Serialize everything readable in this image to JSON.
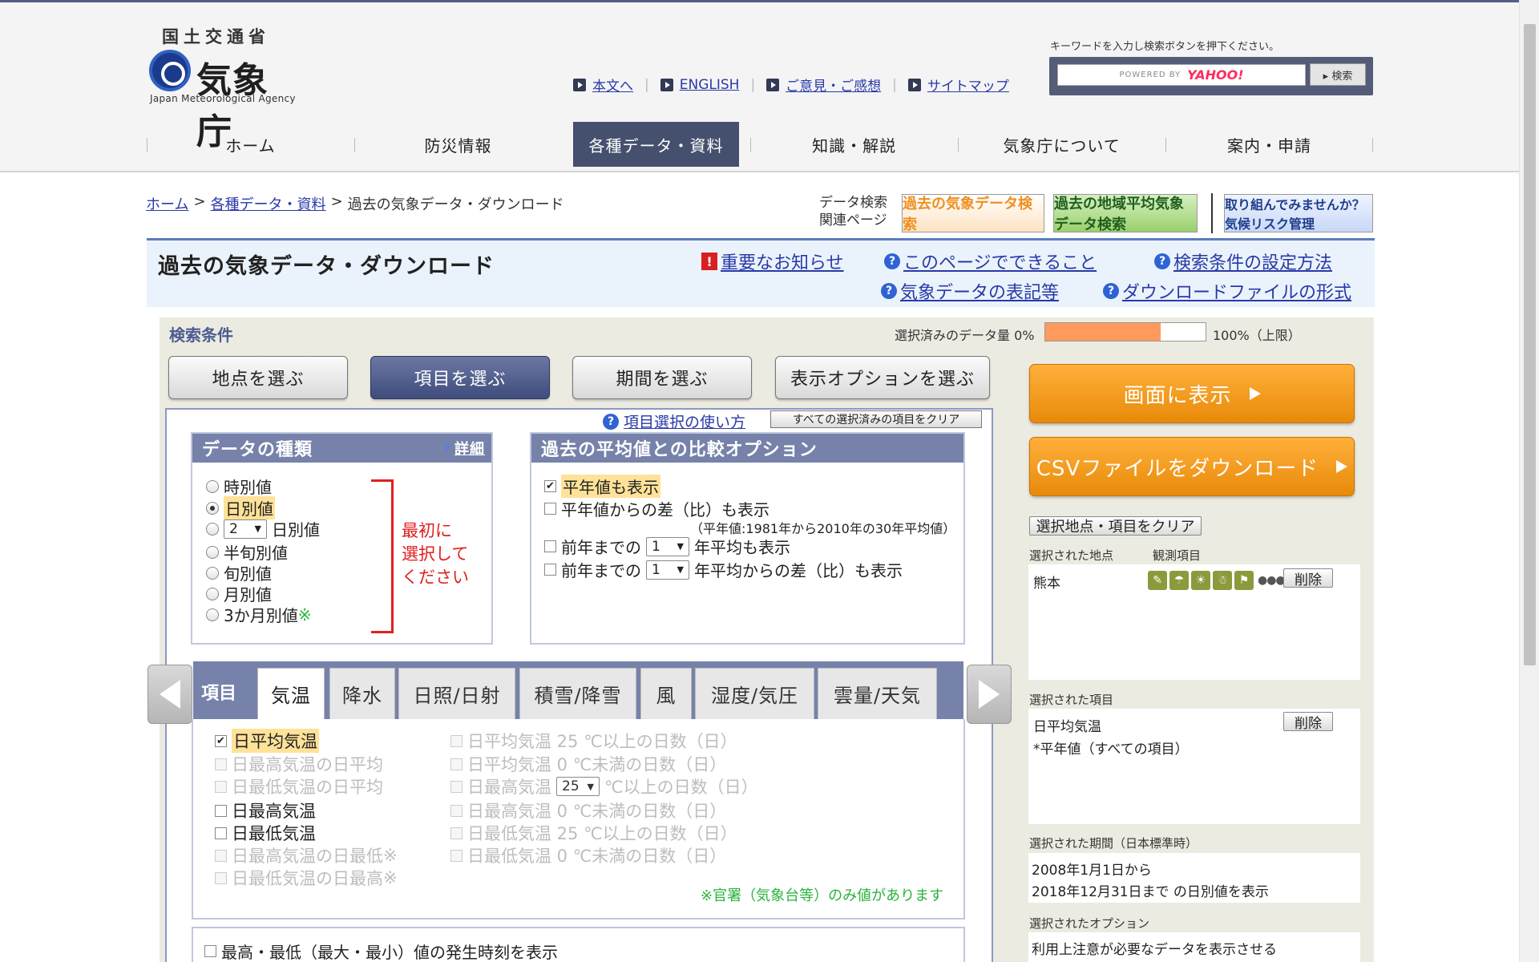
{
  "colors": {
    "accent": "#44506d",
    "orange": "#f39a1e",
    "progress": "#ff9a5c",
    "red_note": "#e02020"
  },
  "header": {
    "ministry": "国土交通省",
    "agency": "気象庁",
    "agency_en": "Japan Meteorological Agency",
    "util_links": [
      "本文へ",
      "ENGLISH",
      "ご意見・ご感想",
      "サイトマップ"
    ],
    "search_hint": "キーワードを入力し検索ボタンを押下ください。",
    "powered_by": "POWERED BY",
    "yahoo": "YAHOO!",
    "search_button": "▸ 検索",
    "nav": [
      "ホーム",
      "防災情報",
      "各種データ・資料",
      "知識・解説",
      "気象庁について",
      "案内・申請"
    ]
  },
  "breadcrumb": {
    "home": "ホーム",
    "data": "各種データ・資料",
    "current": "過去の気象データ・ダウンロード",
    "sep": ">"
  },
  "related": {
    "line1": "データ検索",
    "line2": "関連ページ",
    "banner1": "過去の気象データ検索",
    "banner2": "過去の地域平均気象データ検索",
    "banner3": "取り組んでみませんか？気候リスク管理"
  },
  "title": {
    "main": "過去の気象データ・ダウンロード",
    "links": [
      "重要なお知らせ",
      "このページでできること",
      "検索条件の設定方法",
      "気象データの表記等",
      "ダウンロードファイルの形式"
    ]
  },
  "conditions": {
    "label": "検索条件",
    "amount_label": "選択済みのデータ量 0%",
    "amount_percent": 72,
    "max_label": "100%（上限）",
    "steps": [
      "地点を選ぶ",
      "項目を選ぶ",
      "期間を選ぶ",
      "表示オプションを選ぶ"
    ],
    "howto": "項目選択の使い方",
    "clear_all": "すべての選択済みの項目をクリア"
  },
  "data_type": {
    "header": "データの種類",
    "detail": "詳細",
    "options": [
      "時別値",
      "日別値",
      "日別値",
      "半旬別値",
      "旬別値",
      "月別値",
      "3か月別値"
    ],
    "n_days_value": "2",
    "selected_index": 1,
    "asterisk": "※",
    "note": [
      "最初に",
      "選択して",
      "ください"
    ]
  },
  "compare": {
    "header": "過去の平均値との比較オプション",
    "opt1": "平年値も表示",
    "opt2": "平年値からの差（比）も表示",
    "opt2_note": "（平年値:1981年から2010年の30年平均値）",
    "opt3_pre": "前年までの",
    "opt3_val": "1",
    "opt3_post": "年平均も表示",
    "opt4_pre": "前年までの",
    "opt4_val": "1",
    "opt4_post": "年平均からの差（比）も表示"
  },
  "items": {
    "label": "項目",
    "tabs": [
      "気温",
      "降水",
      "日照/日射",
      "積雪/降雪",
      "風",
      "湿度/気圧",
      "雲量/天気"
    ],
    "left": [
      "日平均気温",
      "日最高気温の日平均",
      "日最低気温の日平均",
      "日最高気温",
      "日最低気温",
      "日最高気温の日最低",
      "日最低気温の日最高"
    ],
    "right": [
      "日平均気温 25 ℃以上の日数（日）",
      "日平均気温 0 ℃未満の日数（日）",
      "日最高気温",
      "℃以上の日数（日）",
      "日最高気温 0 ℃未満の日数（日）",
      "日最低気温 25 ℃以上の日数（日）",
      "日最低気温 0 ℃未満の日数（日）"
    ],
    "threshold_value": "25",
    "asterisk": "※",
    "official_note": "※官署（気象台等）のみ値があります",
    "time_option": "最高・最低（最大・最小）値の発生時刻を表示"
  },
  "right": {
    "show_button": "画面に表示",
    "csv_button": "CSVファイルをダウンロード",
    "clear_button": "選択地点・項目をクリア",
    "station_label": "選択された地点",
    "obs_label": "観測項目",
    "station": "熊本",
    "delete": "削除",
    "item_label": "選択された項目",
    "item": "日平均気温",
    "item_sub": "*平年値（すべての項目）",
    "period_label": "選択された期間（日本標準時）",
    "period_from": "2008年1月1日から",
    "period_to": "2018年12月31日まで の日別値を表示",
    "option_label": "選択されたオプション",
    "option_text": "利用上注意が必要なデータを表示させる",
    "obs_icons": [
      "pencil-icon",
      "umbrella-icon",
      "sun-icon",
      "snowman-icon",
      "wind-icon"
    ]
  }
}
